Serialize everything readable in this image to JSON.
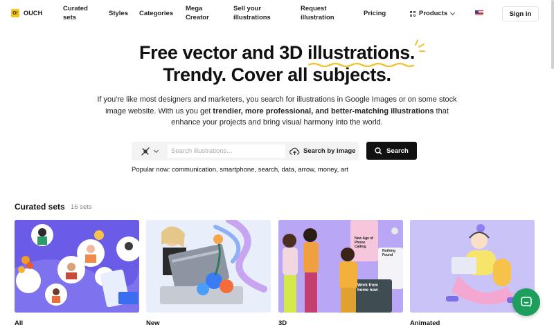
{
  "logo": {
    "mark": "O!",
    "text": "OUCH"
  },
  "nav": {
    "curated": "Curated\nsets",
    "styles": "Styles",
    "categories": "Categories",
    "mega": "Mega\nCreator",
    "sell": "Sell your\nillustrations",
    "request": "Request\nillustration",
    "pricing": "Pricing",
    "products": "Products",
    "signin": "Sign in"
  },
  "hero": {
    "line1_prefix": "Free vector and 3D ",
    "line1_highlight": "illustrations.",
    "line2": "Trendy. Cover all subjects.",
    "desc_part1": "If you're like most designers and marketers, you search for illustrations in Google Images or on some stock image website. With us you get ",
    "desc_bold": "trendier, more professional, and better-matching illustrations",
    "desc_part2": " that enhance your projects and bring visual harmony into the world.",
    "accent": "#f2c12e"
  },
  "search": {
    "placeholder": "Search illustrations...",
    "by_image": "Search by image",
    "button": "Search",
    "popular": "Popular now: communication, smartphone, search, data, arrow, money, art"
  },
  "curated": {
    "title": "Curated sets",
    "count": "16 sets",
    "cards": [
      {
        "label": "All",
        "bg": "#6b5ce7"
      },
      {
        "label": "New",
        "bg": "#e9eefb"
      },
      {
        "label": "3D",
        "bg": "#b9a7f5"
      },
      {
        "label": "Animated",
        "bg": "#c9c3f7"
      }
    ]
  },
  "card3_texts": {
    "badge1": "New Age of Phone Calling",
    "badge2": "Nothing Found",
    "badge3": "Work from home now"
  },
  "chat": {
    "color": "#1e9e5c"
  }
}
